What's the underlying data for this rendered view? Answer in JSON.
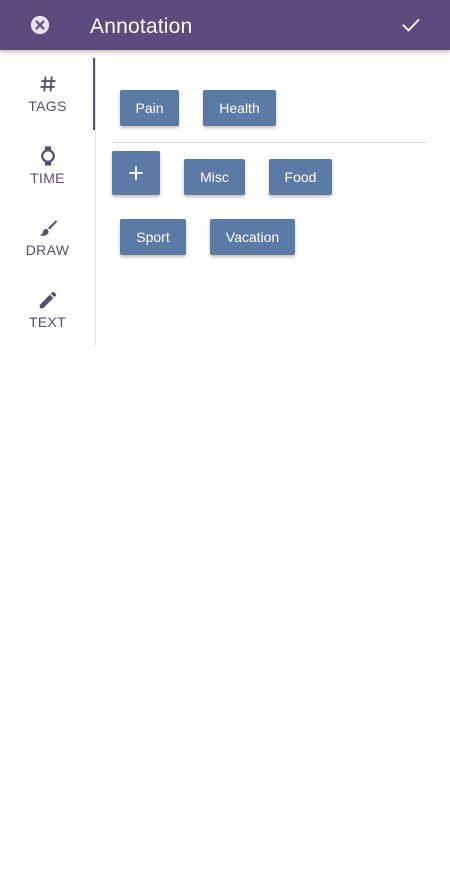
{
  "app_bar": {
    "title": "Annotation",
    "close_icon": "close-circle-icon",
    "confirm_icon": "check-icon",
    "background": "#5c4b7d"
  },
  "sidenav": {
    "items": [
      {
        "label": "TAGS",
        "icon": "hash-icon",
        "active": true
      },
      {
        "label": "TIME",
        "icon": "watch-icon",
        "active": false
      },
      {
        "label": "DRAW",
        "icon": "brush-icon",
        "active": false
      },
      {
        "label": "TEXT",
        "icon": "pencil-icon",
        "active": false
      }
    ]
  },
  "tags": {
    "selected": [
      "Pain",
      "Health"
    ],
    "add_icon": "plus-icon",
    "available": [
      "Misc",
      "Food",
      "Sport",
      "Vacation"
    ],
    "chip_color": "#5b7aa6"
  }
}
